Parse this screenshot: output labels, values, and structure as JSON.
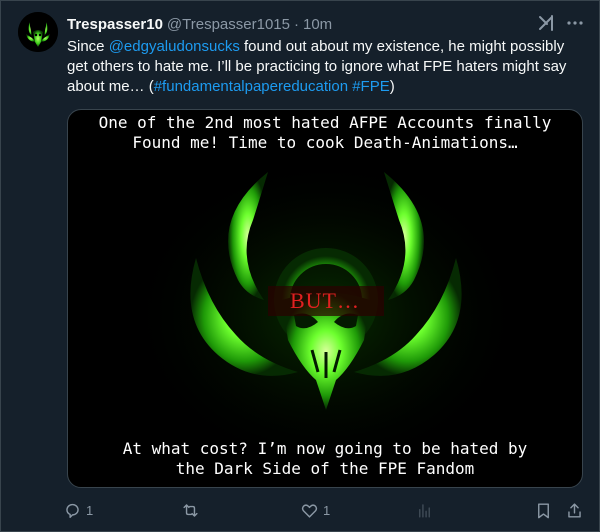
{
  "tweet": {
    "author_name": "Trespasser10",
    "author_handle": "@Trespasser1015",
    "separator": "·",
    "time": "10m",
    "text_part1": "Since ",
    "mention": "@edgyaludonsucks",
    "text_part2": " found out about my existence, he might possibly get others to hate me. I’ll be practicing to ignore what FPE haters might say about me… (",
    "hashtag1": "#fundamentalpapereducation",
    "text_part3": " ",
    "hashtag2": "#FPE",
    "text_part4": ")"
  },
  "media": {
    "caption_top_line1": "One of the 2nd most hated AFPE Accounts finally",
    "caption_top_line2": "Found me! Time to cook Death-Animations…",
    "center_text": "BUT…",
    "caption_bottom_line1": "At what cost? I’m now going to be hated by",
    "caption_bottom_line2": "the Dark Side of the FPE Fandom"
  },
  "actions": {
    "reply_count": "1",
    "retweet_count": "",
    "like_count": "1",
    "views_count": ""
  },
  "icons": {
    "avatar": "biohazard-skull-avatar",
    "grok": "grok-icon",
    "more": "more-icon",
    "reply": "reply-icon",
    "retweet": "retweet-icon",
    "like": "heart-icon",
    "views": "views-icon",
    "bookmark": "bookmark-icon",
    "share": "share-icon"
  },
  "colors": {
    "background": "#15202b",
    "text": "#f7f9f9",
    "muted": "#8b98a5",
    "link": "#1d9bf0",
    "glow": "#4cff2a",
    "but_text": "#e02020"
  }
}
